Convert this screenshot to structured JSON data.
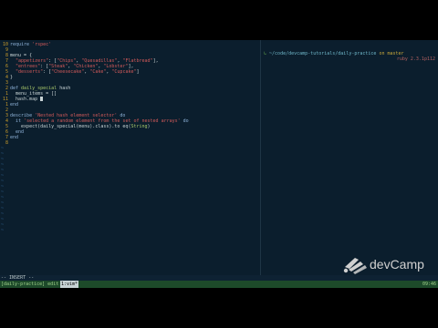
{
  "editor": {
    "lines": [
      {
        "n": "10",
        "parts": [
          [
            "kw",
            "require "
          ],
          [
            "str",
            "'rspec'"
          ]
        ]
      },
      {
        "n": "9",
        "parts": []
      },
      {
        "n": "8",
        "parts": [
          [
            "pl",
            "menu = {"
          ]
        ]
      },
      {
        "n": "7",
        "parts": [
          [
            "sym",
            "  \"appetizers\""
          ],
          [
            "pl",
            ": ["
          ],
          [
            "str",
            "\"Chips\""
          ],
          [
            "pl",
            ", "
          ],
          [
            "str",
            "\"Quesadillas\""
          ],
          [
            "pl",
            ", "
          ],
          [
            "str",
            "\"Flatbread\""
          ],
          [
            "pl",
            "],"
          ]
        ]
      },
      {
        "n": "6",
        "parts": [
          [
            "sym",
            "  \"entrees\""
          ],
          [
            "pl",
            ": ["
          ],
          [
            "str",
            "\"Steak\""
          ],
          [
            "pl",
            ", "
          ],
          [
            "str",
            "\"Chicken\""
          ],
          [
            "pl",
            ", "
          ],
          [
            "str",
            "\"Lobster\""
          ],
          [
            "pl",
            "],"
          ]
        ]
      },
      {
        "n": "5",
        "parts": [
          [
            "sym",
            "  \"desserts\""
          ],
          [
            "pl",
            ": ["
          ],
          [
            "str",
            "\"Cheesecake\""
          ],
          [
            "pl",
            ", "
          ],
          [
            "str",
            "\"Cake\""
          ],
          [
            "pl",
            ", "
          ],
          [
            "str",
            "\"Cupcake\""
          ],
          [
            "pl",
            "]"
          ]
        ]
      },
      {
        "n": "4",
        "parts": [
          [
            "pl",
            "}"
          ]
        ]
      },
      {
        "n": "3",
        "parts": []
      },
      {
        "n": "2",
        "parts": [
          [
            "kw",
            "def "
          ],
          [
            "cls",
            "daily_special"
          ],
          [
            "pl",
            " hash"
          ]
        ]
      },
      {
        "n": "1",
        "parts": [
          [
            "pl",
            "  menu_items = []"
          ]
        ]
      },
      {
        "n": "11",
        "parts": [
          [
            "pl",
            "  hash.map "
          ]
        ],
        "cursor": true
      },
      {
        "n": "1",
        "parts": [
          [
            "kw",
            "end"
          ]
        ]
      },
      {
        "n": "2",
        "parts": []
      },
      {
        "n": "3",
        "parts": [
          [
            "kw",
            "describe "
          ],
          [
            "str",
            "'Nested hash element selector'"
          ],
          [
            "kw",
            " do"
          ]
        ]
      },
      {
        "n": "4",
        "parts": [
          [
            "kw",
            "  it "
          ],
          [
            "str",
            "'selected a random element from the set of nested arrays'"
          ],
          [
            "kw",
            " do"
          ]
        ]
      },
      {
        "n": "5",
        "parts": [
          [
            "pl",
            "    expect(daily_special(menu).class).to eq("
          ],
          [
            "cls",
            "String"
          ],
          [
            "pl",
            ")"
          ]
        ]
      },
      {
        "n": "6",
        "parts": [
          [
            "kw",
            "  end"
          ]
        ]
      },
      {
        "n": "7",
        "parts": [
          [
            "kw",
            "end"
          ]
        ]
      },
      {
        "n": "8",
        "parts": []
      }
    ],
    "tilde_count": 16
  },
  "terminal": {
    "arrow": "↳",
    "path": "~/code/devcamp-tutorials/daily-practice",
    "branch_text": " on master",
    "ruby": "ruby 2.3.1p112"
  },
  "status": {
    "mode": "-- INSERT --"
  },
  "tmux": {
    "session": "[daily-practice] edit",
    "window": "1:vim*",
    "clock": "09:46"
  },
  "logo": {
    "text": "devCamp"
  },
  "colors": {
    "background": "#0b1e2d",
    "line_number": "#c89b2a",
    "string": "#d35a5a",
    "keyword": "#8fb3d9",
    "tmux_bar": "#1d4a2a"
  }
}
